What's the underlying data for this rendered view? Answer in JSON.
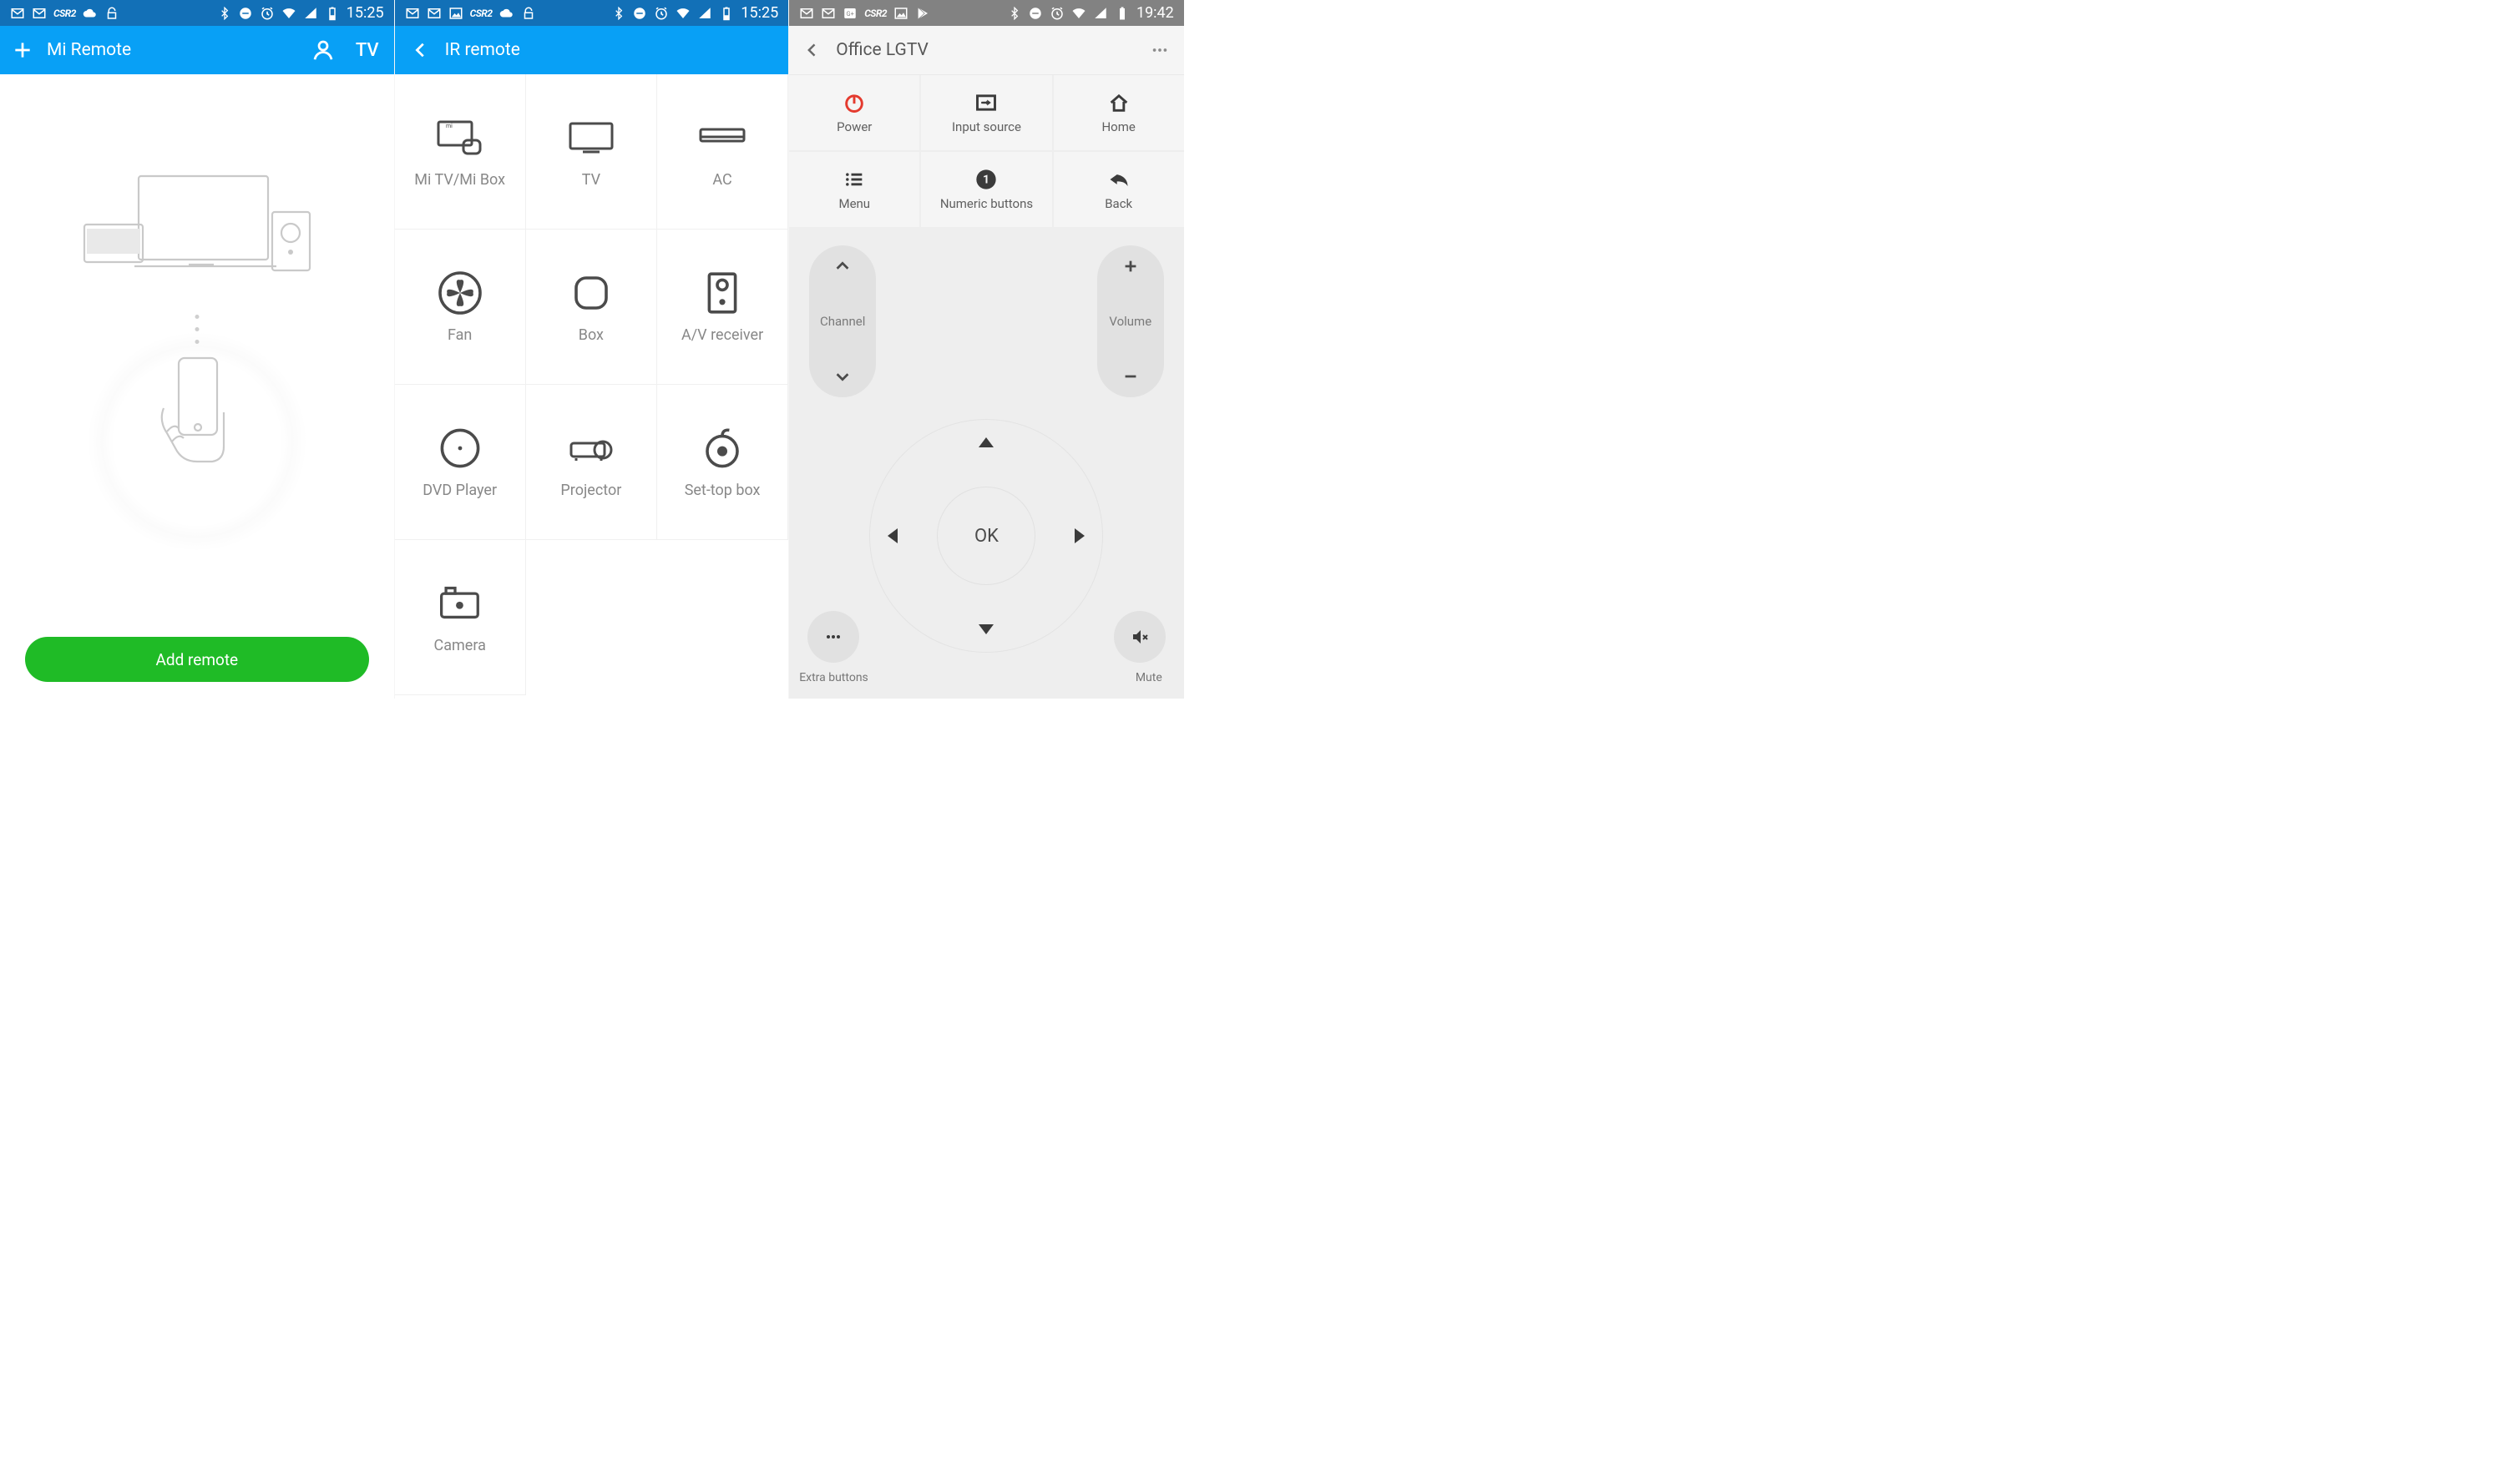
{
  "screen1": {
    "status_time": "15:25",
    "app_title": "Mi Remote",
    "tv_label": "TV",
    "add_remote": "Add remote"
  },
  "screen2": {
    "status_time": "15:25",
    "app_title": "IR remote",
    "devices": [
      "Mi TV/Mi Box",
      "TV",
      "AC",
      "Fan",
      "Box",
      "A/V receiver",
      "DVD Player",
      "Projector",
      "Set-top box",
      "Camera"
    ]
  },
  "screen3": {
    "status_time": "19:42",
    "app_title": "Office LGTV",
    "fn": [
      "Power",
      "Input source",
      "Home",
      "Menu",
      "Numeric buttons",
      "Back"
    ],
    "channel": "Channel",
    "volume": "Volume",
    "ok": "OK",
    "extra": "Extra buttons",
    "mute": "Mute"
  }
}
